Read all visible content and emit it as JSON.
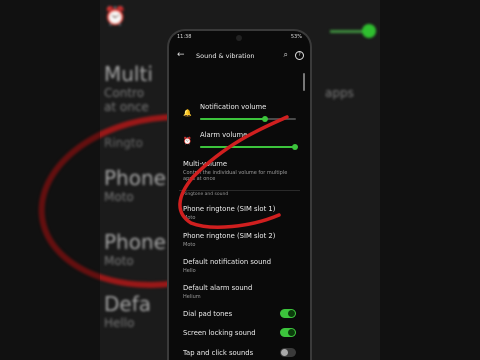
{
  "background": {
    "big_texts": [
      "Multi",
      "Ringto",
      "Phone",
      "Phone",
      "Defa"
    ],
    "small_texts": [
      "Contro",
      "at once",
      "Moto",
      "Moto",
      "Hello"
    ],
    "right_texts": [
      "apps"
    ]
  },
  "status_bar": {
    "time": "11:38",
    "battery": "53%"
  },
  "app_bar": {
    "title": "Sound & vibration"
  },
  "items": {
    "notification_volume": {
      "label": "Notification volume",
      "level": 0.68
    },
    "alarm_volume": {
      "label": "Alarm volume",
      "level": 0.99
    },
    "multi_volume": {
      "label": "Multi-volume",
      "sub": "Control the individual volume for multiple apps at once"
    },
    "section_ringtone": "Ringtone and sound",
    "phone_ringtone_1": {
      "label": "Phone ringtone (SIM slot 1)",
      "sub": "Moto"
    },
    "phone_ringtone_2": {
      "label": "Phone ringtone (SIM slot 2)",
      "sub": "Moto"
    },
    "default_notification": {
      "label": "Default notification sound",
      "sub": "Hello"
    },
    "default_alarm": {
      "label": "Default alarm sound",
      "sub": "Helium"
    },
    "dial_pad": {
      "label": "Dial pad tones",
      "on": true
    },
    "screen_locking": {
      "label": "Screen locking sound",
      "on": true
    },
    "tap_click": {
      "label": "Tap and click sounds",
      "on": false
    }
  },
  "colors": {
    "accent": "#3cc43c",
    "annotation": "#d01f1f"
  }
}
